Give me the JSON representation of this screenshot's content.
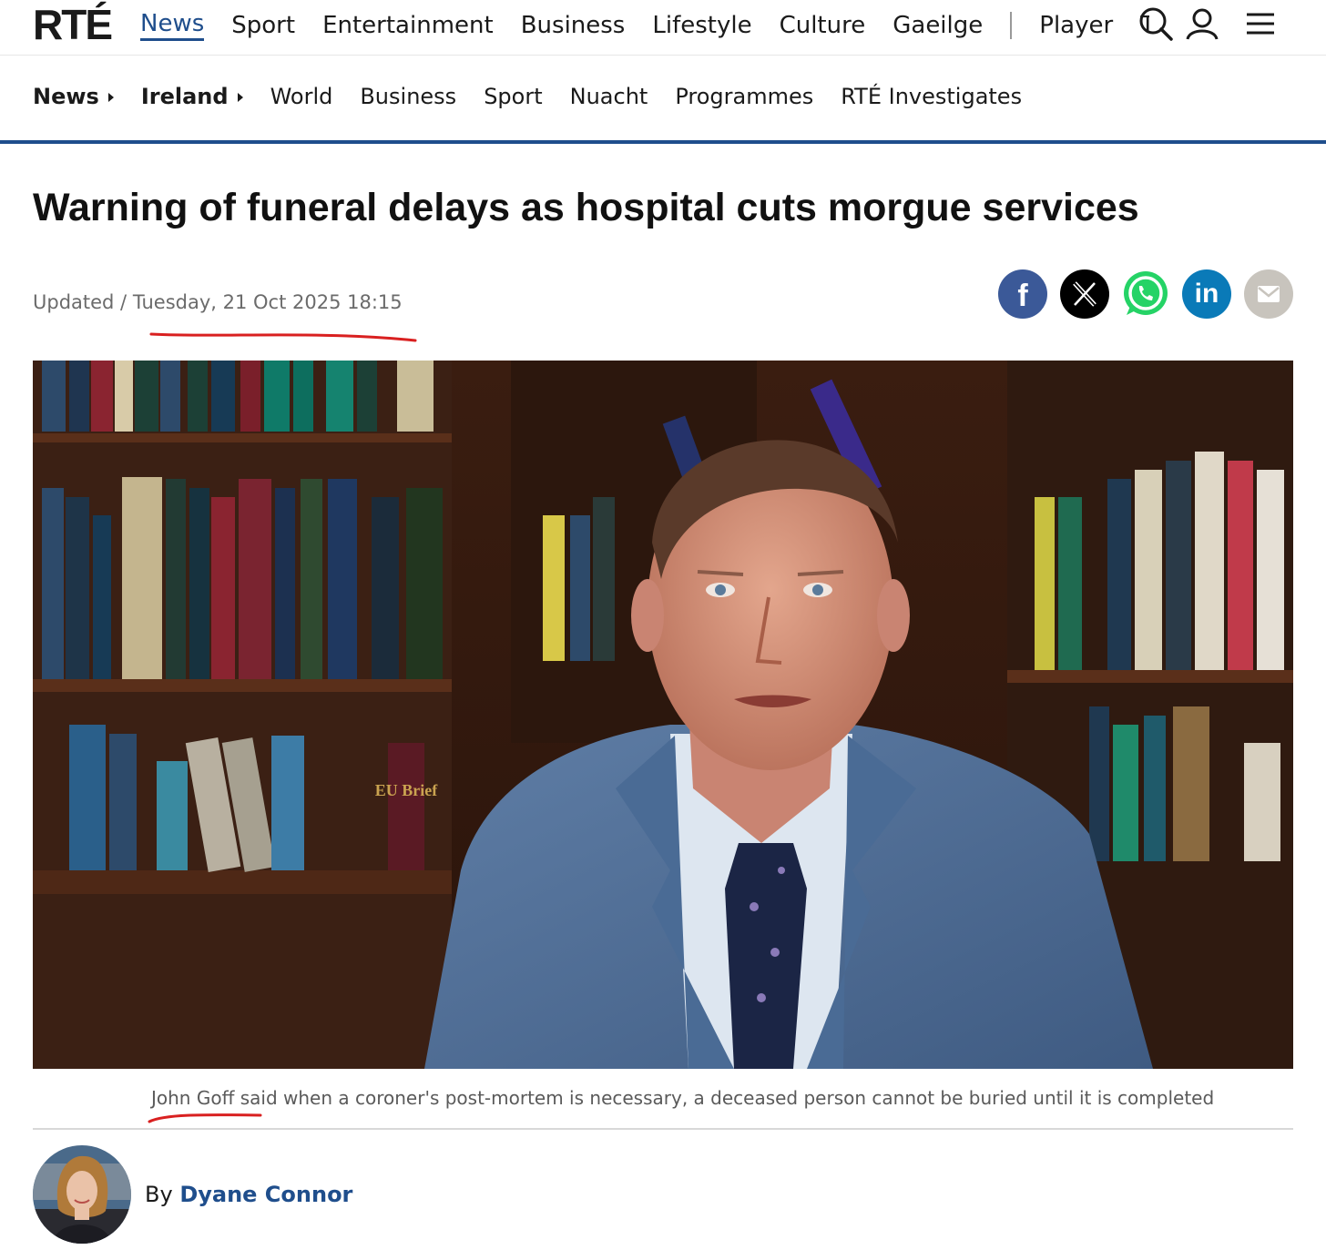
{
  "brand": {
    "logo": "RTÉ"
  },
  "topnav": {
    "items": [
      "News",
      "Sport",
      "Entertainment",
      "Business",
      "Lifestyle",
      "Culture",
      "Gaeilge"
    ],
    "player": "Player",
    "truncated": "T",
    "icons": [
      "search-icon",
      "account-icon",
      "menu-icon"
    ]
  },
  "subnav": {
    "news": "News",
    "ireland": "Ireland",
    "items": [
      "World",
      "Business",
      "Sport",
      "Nuacht",
      "Programmes",
      "RTÉ Investigates"
    ]
  },
  "article": {
    "headline": "Warning of funeral delays as hospital cuts morgue services",
    "updated_label": "Updated /",
    "updated_date": "Tuesday, 21 Oct 2025 18:15",
    "caption": "John Goff said when a coroner's post-mortem is necessary, a deceased person cannot be buried until it is completed",
    "photo_text": {
      "book_label": "EU Brief"
    },
    "byline_prefix": "By",
    "author": "Dyane Connor"
  },
  "share": [
    "facebook-icon",
    "x-icon",
    "whatsapp-icon",
    "linkedin-icon",
    "email-icon"
  ],
  "colors": {
    "accent": "#1f4e8c",
    "facebook": "#3b5998",
    "x": "#000000",
    "whatsapp": "#25d366",
    "linkedin": "#0a7ab8",
    "email": "#c8c4bd",
    "annotation": "#d92020"
  }
}
